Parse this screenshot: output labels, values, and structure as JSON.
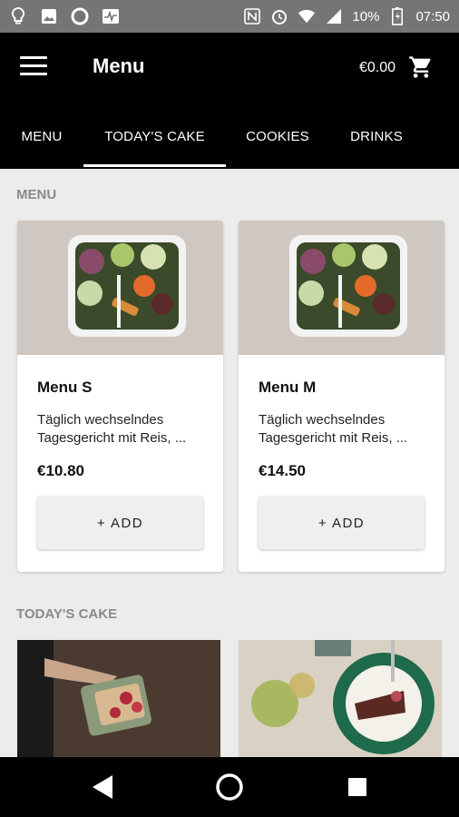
{
  "status_bar": {
    "battery": "10%",
    "time": "07:50",
    "icons": [
      "lightbulb-icon",
      "image-icon",
      "circle-icon",
      "pulse-icon",
      "nfc-icon",
      "alarm-icon",
      "wifi-icon",
      "signal-icon",
      "battery-icon"
    ]
  },
  "toolbar": {
    "title": "Menu",
    "cart_total": "€0.00"
  },
  "tabs": [
    {
      "label": "MENU",
      "active": false
    },
    {
      "label": "TODAY'S CAKE",
      "active": true
    },
    {
      "label": "COOKIES",
      "active": false
    },
    {
      "label": "DRINKS",
      "active": false
    }
  ],
  "sections": [
    {
      "title": "MENU",
      "items": [
        {
          "name": "Menu S",
          "description": "Täglich wechselndes Tagesgericht mit Reis, ...",
          "price": "€10.80",
          "add_label": "+ ADD"
        },
        {
          "name": "Menu M",
          "description": "Täglich wechselndes Tagesgericht mit Reis, ...",
          "price": "€14.50",
          "add_label": "+ ADD"
        }
      ]
    },
    {
      "title": "TODAY'S CAKE",
      "items": []
    }
  ],
  "colors": {
    "toolbar_bg": "#000000",
    "status_bar_bg": "#757575",
    "page_bg": "#ececec",
    "section_title": "#8a8a8a"
  }
}
